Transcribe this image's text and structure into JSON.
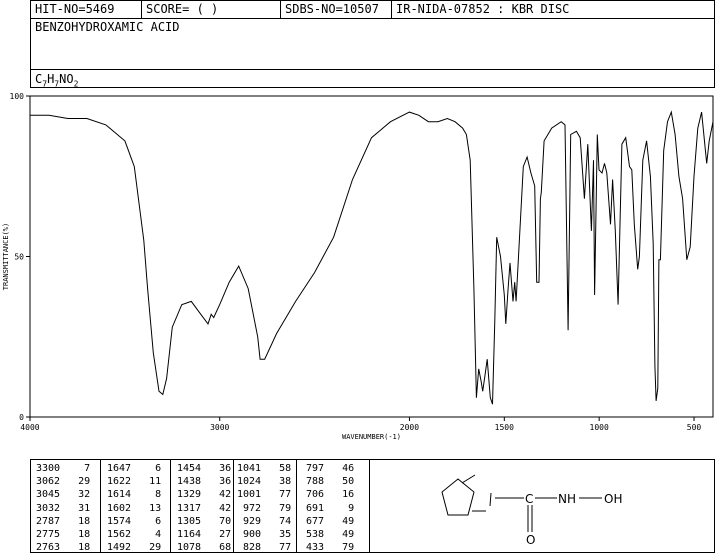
{
  "header": {
    "hit_no": "HIT-NO=5469",
    "score": "SCORE=  (   )",
    "sdbs_no": "SDBS-NO=10507",
    "ir_nida": "IR-NIDA-07852 : KBR DISC"
  },
  "compound": {
    "name": "BENZOHYDROXAMIC ACID",
    "formula": {
      "c": "C",
      "c_n": "7",
      "h": "H",
      "h_n": "7",
      "n": "N",
      "o": "O",
      "o_n": "2"
    }
  },
  "structure_labels": {
    "carbon": "C",
    "nh": "NH",
    "oh": "OH",
    "oxygen": "O"
  },
  "chart_data": {
    "type": "line",
    "xlabel": "WAVENUMBER(-1)",
    "ylabel": "TRANSMITTANCE(%)",
    "xlim": [
      4000,
      400
    ],
    "ylim": [
      0,
      100
    ],
    "x_ticks": [
      4000,
      3000,
      2000,
      1500,
      1000,
      500
    ],
    "y_ticks": [
      0,
      50,
      100
    ],
    "grid": false,
    "x": [
      4000,
      3900,
      3800,
      3700,
      3600,
      3500,
      3450,
      3400,
      3380,
      3350,
      3320,
      3300,
      3280,
      3250,
      3200,
      3150,
      3100,
      3062,
      3045,
      3032,
      3000,
      2950,
      2900,
      2850,
      2800,
      2787,
      2775,
      2763,
      2700,
      2600,
      2500,
      2400,
      2300,
      2200,
      2100,
      2000,
      1950,
      1900,
      1850,
      1800,
      1760,
      1720,
      1700,
      1680,
      1660,
      1647,
      1635,
      1622,
      1614,
      1602,
      1590,
      1574,
      1562,
      1550,
      1540,
      1520,
      1500,
      1492,
      1480,
      1470,
      1454,
      1445,
      1438,
      1425,
      1400,
      1380,
      1360,
      1340,
      1329,
      1317,
      1310,
      1305,
      1290,
      1250,
      1200,
      1180,
      1164,
      1150,
      1120,
      1100,
      1078,
      1060,
      1041,
      1030,
      1024,
      1010,
      1001,
      985,
      972,
      960,
      940,
      929,
      915,
      900,
      880,
      860,
      840,
      828,
      815,
      797,
      788,
      770,
      750,
      730,
      715,
      706,
      700,
      691,
      685,
      677,
      660,
      640,
      620,
      600,
      580,
      560,
      538,
      520,
      500,
      480,
      460,
      433,
      420,
      400
    ],
    "y": [
      94,
      94,
      93,
      93,
      91,
      86,
      78,
      55,
      40,
      20,
      8,
      7,
      12,
      28,
      35,
      36,
      32,
      29,
      32,
      31,
      35,
      42,
      47,
      40,
      25,
      18,
      18,
      18,
      26,
      36,
      45,
      56,
      74,
      87,
      92,
      95,
      94,
      92,
      92,
      93,
      92,
      90,
      88,
      80,
      40,
      6,
      15,
      11,
      8,
      13,
      18,
      6,
      4,
      30,
      56,
      50,
      38,
      29,
      40,
      48,
      36,
      42,
      36,
      50,
      78,
      81,
      76,
      72,
      42,
      42,
      68,
      70,
      86,
      90,
      92,
      91,
      27,
      88,
      89,
      87,
      68,
      85,
      58,
      80,
      38,
      88,
      77,
      76,
      79,
      76,
      60,
      74,
      58,
      35,
      85,
      87,
      78,
      77,
      60,
      46,
      50,
      80,
      86,
      75,
      54,
      16,
      5,
      9,
      49,
      49,
      83,
      92,
      95,
      88,
      75,
      68,
      49,
      53,
      75,
      90,
      95,
      79,
      86,
      92
    ]
  },
  "peak_table": [
    {
      "wn": "3300",
      "t": "7"
    },
    {
      "wn": "3062",
      "t": "29"
    },
    {
      "wn": "3045",
      "t": "32"
    },
    {
      "wn": "3032",
      "t": "31"
    },
    {
      "wn": "2787",
      "t": "18"
    },
    {
      "wn": "2775",
      "t": "18"
    },
    {
      "wn": "2763",
      "t": "18"
    },
    {
      "wn": "1647",
      "t": "6"
    },
    {
      "wn": "1622",
      "t": "11"
    },
    {
      "wn": "1614",
      "t": "8"
    },
    {
      "wn": "1602",
      "t": "13"
    },
    {
      "wn": "1574",
      "t": "6"
    },
    {
      "wn": "1562",
      "t": "4"
    },
    {
      "wn": "1492",
      "t": "29"
    },
    {
      "wn": "1454",
      "t": "36"
    },
    {
      "wn": "1438",
      "t": "36"
    },
    {
      "wn": "1329",
      "t": "42"
    },
    {
      "wn": "1317",
      "t": "42"
    },
    {
      "wn": "1305",
      "t": "70"
    },
    {
      "wn": "1164",
      "t": "27"
    },
    {
      "wn": "1078",
      "t": "68"
    },
    {
      "wn": "1041",
      "t": "58"
    },
    {
      "wn": "1024",
      "t": "38"
    },
    {
      "wn": "1001",
      "t": "77"
    },
    {
      "wn": "972",
      "t": "79"
    },
    {
      "wn": "929",
      "t": "74"
    },
    {
      "wn": "900",
      "t": "35"
    },
    {
      "wn": "828",
      "t": "77"
    },
    {
      "wn": "797",
      "t": "46"
    },
    {
      "wn": "788",
      "t": "50"
    },
    {
      "wn": "706",
      "t": "16"
    },
    {
      "wn": "691",
      "t": "9"
    },
    {
      "wn": "677",
      "t": "49"
    },
    {
      "wn": "538",
      "t": "49"
    },
    {
      "wn": "433",
      "t": "79"
    }
  ]
}
